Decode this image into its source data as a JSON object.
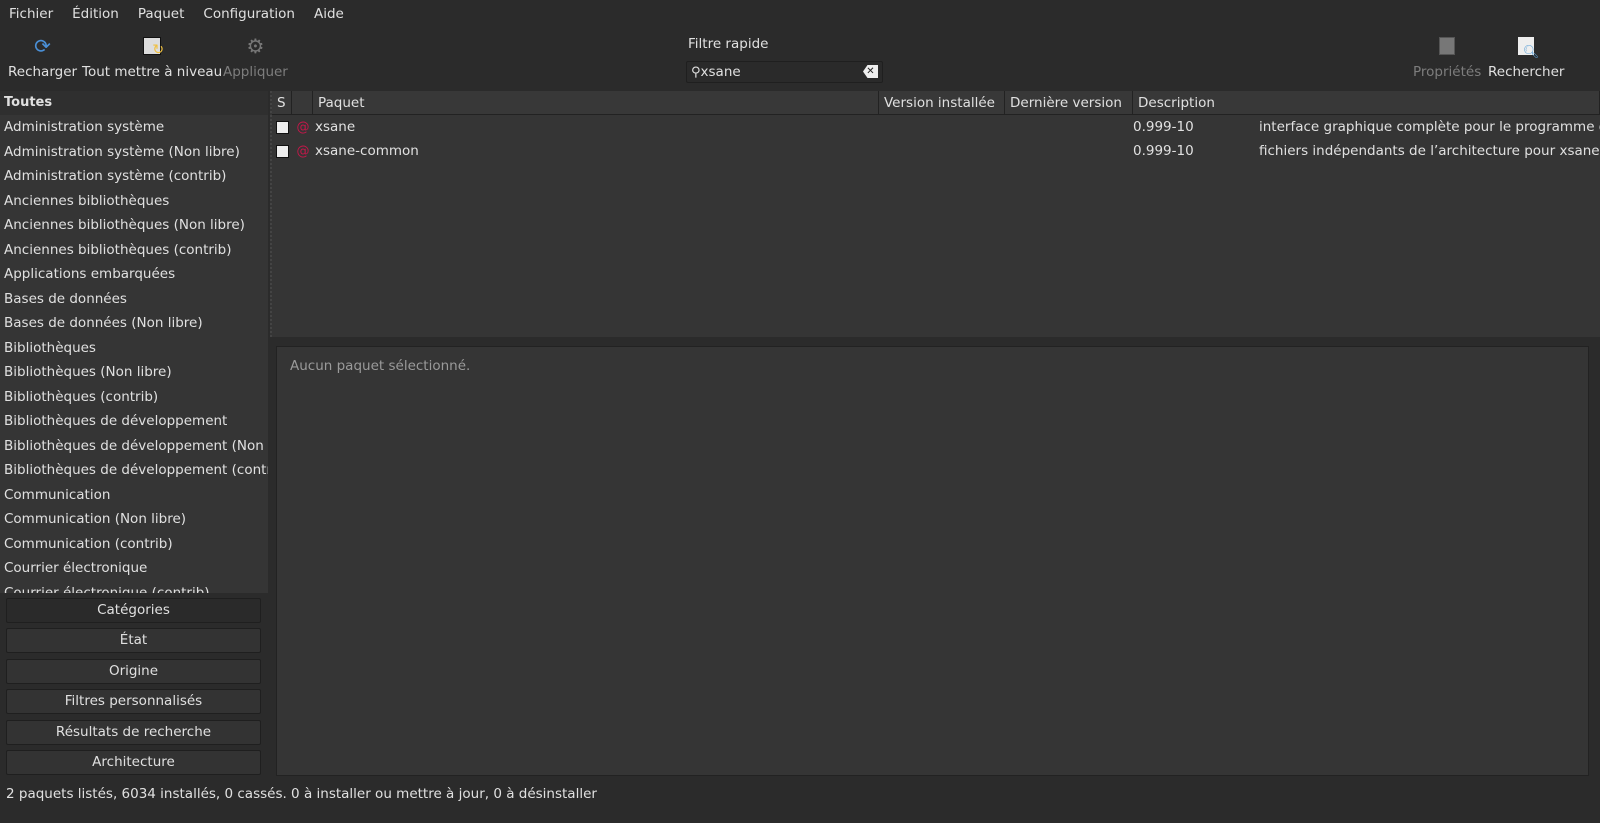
{
  "menu": [
    "Fichier",
    "Édition",
    "Paquet",
    "Configuration",
    "Aide"
  ],
  "toolbar": {
    "reload": "Recharger",
    "upgrade_all": "Tout mettre à niveau",
    "apply": "Appliquer",
    "properties": "Propriétés",
    "search": "Rechercher"
  },
  "filter": {
    "label": "Filtre rapide",
    "value": "xsane"
  },
  "sidebar": {
    "header": "Toutes",
    "items": [
      "Administration système",
      "Administration système (Non libre)",
      "Administration système (contrib)",
      "Anciennes bibliothèques",
      "Anciennes bibliothèques (Non libre)",
      "Anciennes bibliothèques (contrib)",
      "Applications embarquées",
      "Bases de données",
      "Bases de données (Non libre)",
      "Bibliothèques",
      "Bibliothèques (Non libre)",
      "Bibliothèques (contrib)",
      "Bibliothèques de développement",
      "Bibliothèques de développement (Non libre)",
      "Bibliothèques de développement (contrib)",
      "Communication",
      "Communication (Non libre)",
      "Communication (contrib)",
      "Courrier électronique",
      "Courrier électronique (contrib)"
    ]
  },
  "filter_buttons": [
    "Catégories",
    "État",
    "Origine",
    "Filtres personnalisés",
    "Résultats de recherche",
    "Architecture"
  ],
  "columns": [
    "S",
    "",
    "Paquet",
    "Version installée",
    "Dernière version",
    "Description"
  ],
  "packages": [
    {
      "name": "xsane",
      "installed": "",
      "latest": "0.999-10",
      "description": "interface graphique complète pour le programme de gestion de scanner SANE"
    },
    {
      "name": "xsane-common",
      "installed": "",
      "latest": "0.999-10",
      "description": "fichiers indépendants de l’architecture pour xsane"
    }
  ],
  "details": "Aucun paquet sélectionné.",
  "status": "2 paquets listés, 6034 installés, 0 cassés. 0 à installer ou mettre à jour, 0 à désinstaller"
}
